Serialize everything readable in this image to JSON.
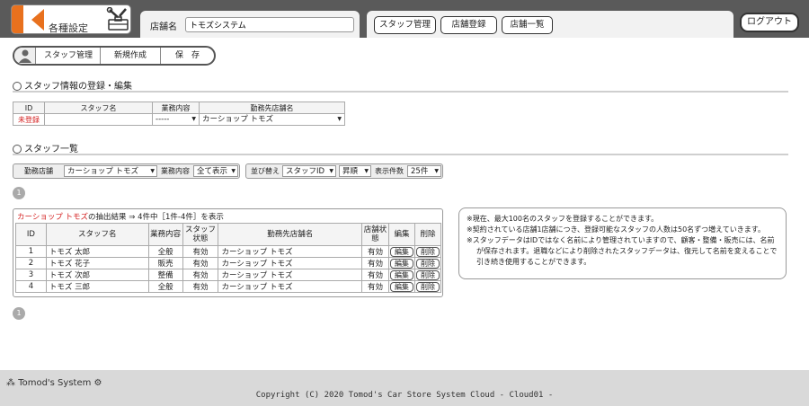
{
  "header": {
    "title": "各種設定",
    "store_label": "店舗名",
    "store_value": "トモズシステム",
    "nav": [
      "スタッフ管理",
      "店舗登録",
      "店舗一覧"
    ],
    "logout": "ログアウト"
  },
  "toolbar": {
    "staff_manage": "スタッフ管理",
    "new": "新規作成",
    "save": "保　存"
  },
  "form_section": {
    "title": "スタッフ情報の登録・編集",
    "headers": [
      "ID",
      "スタッフ名",
      "業務内容",
      "勤務先店舗名"
    ],
    "id_value": "未登録",
    "name_value": "",
    "job_value": "-----",
    "store_value": "カーショップ トモズ"
  },
  "list_section": {
    "title": "スタッフ一覧",
    "filter": {
      "store_label": "勤務店舗",
      "store_value": "カーショップ トモズ",
      "job_label": "業務内容",
      "job_value": "全て表示",
      "sort_label": "並び替え",
      "sort_value": "スタッフID",
      "order_value": "昇順",
      "count_label": "表示件数",
      "count_value": "25件"
    },
    "page": "1",
    "summary_store": "カーショップ トモズ",
    "summary_text": "の抽出結果 ⇒ 4件中［1件-4件］を表示",
    "columns": [
      "ID",
      "スタッフ名",
      "業務内容",
      "スタッフ状態",
      "勤務先店舗名",
      "店舗状態",
      "編集",
      "削除"
    ],
    "rows": [
      {
        "id": "1",
        "name": "トモズ 太郎",
        "job": "全般",
        "status": "有効",
        "store": "カーショップ トモズ",
        "store_status": "有効"
      },
      {
        "id": "2",
        "name": "トモズ 花子",
        "job": "販売",
        "status": "有効",
        "store": "カーショップ トモズ",
        "store_status": "有効"
      },
      {
        "id": "3",
        "name": "トモズ 次郎",
        "job": "整備",
        "status": "有効",
        "store": "カーショップ トモズ",
        "store_status": "有効"
      },
      {
        "id": "4",
        "name": "トモズ 三郎",
        "job": "全般",
        "status": "有効",
        "store": "カーショップ トモズ",
        "store_status": "有効"
      }
    ],
    "edit_label": "編集",
    "delete_label": "削除"
  },
  "notes": [
    "※現在、最大100名のスタッフを登録することができます。",
    "※契約されている店舗1店舗につき、登録可能なスタッフの人数は50名ずつ増えていきます。",
    "※スタッフデータはIDではなく名前により管理されていますので、顧客・整備・販売には、名前が保存されます。退職などにより削除されたスタッフデータは、復元して名前を変えることで引き続き使用することができます。"
  ],
  "footer": {
    "brand": "Tomod's System",
    "copyright": "Copyright (C) 2020 Tomod's Car Store System Cloud - Cloud01 -"
  },
  "colors": {
    "accent": "#e8711e",
    "header_bg": "#5a5a5a",
    "red": "#d42020"
  }
}
